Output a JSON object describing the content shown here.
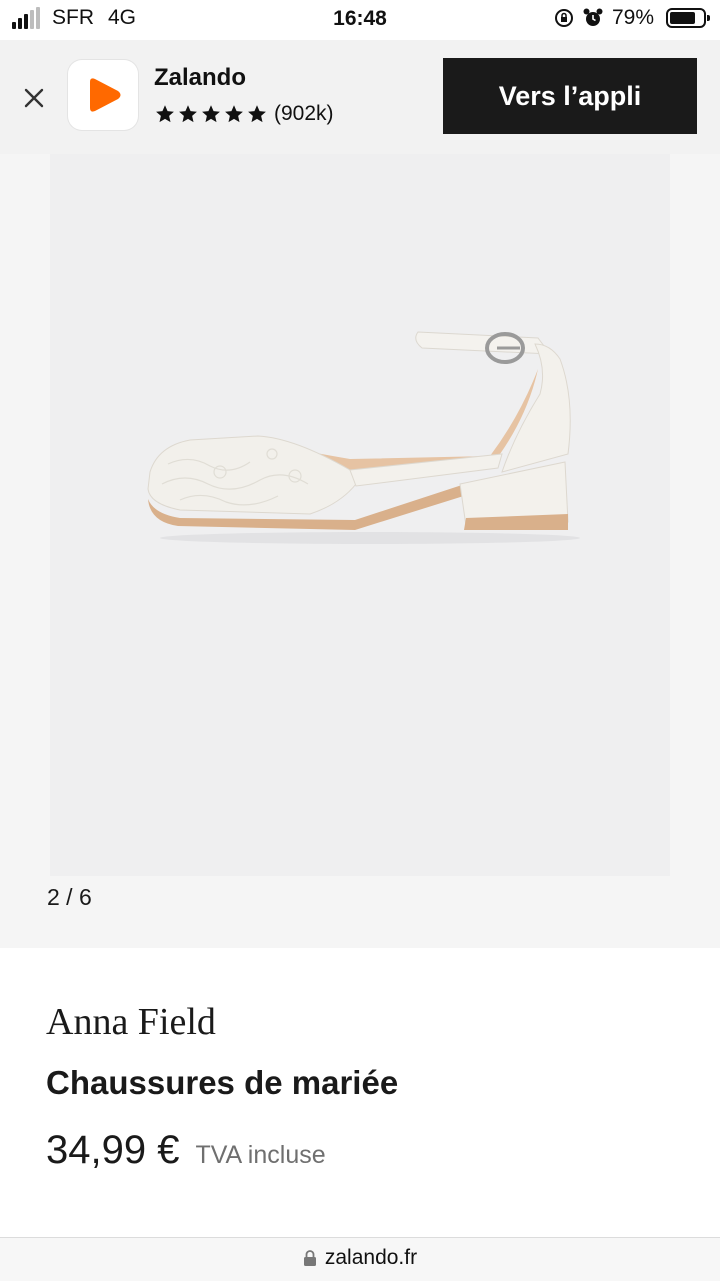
{
  "status_bar": {
    "carrier": "SFR",
    "network": "4G",
    "time": "16:48",
    "battery_percent": "79%",
    "battery_level": 0.79
  },
  "app_banner": {
    "app_name": "Zalando",
    "rating_stars": 5,
    "rating_count": "(902k)",
    "cta_label": "Vers l’appli",
    "brand_color": "#ff6900"
  },
  "gallery": {
    "counter": "2 / 6"
  },
  "product": {
    "brand": "Anna Field",
    "name": "Chaussures de mariée",
    "price": "34,99 €",
    "vat_note": "TVA incluse"
  },
  "browser": {
    "url": "zalando.fr"
  }
}
